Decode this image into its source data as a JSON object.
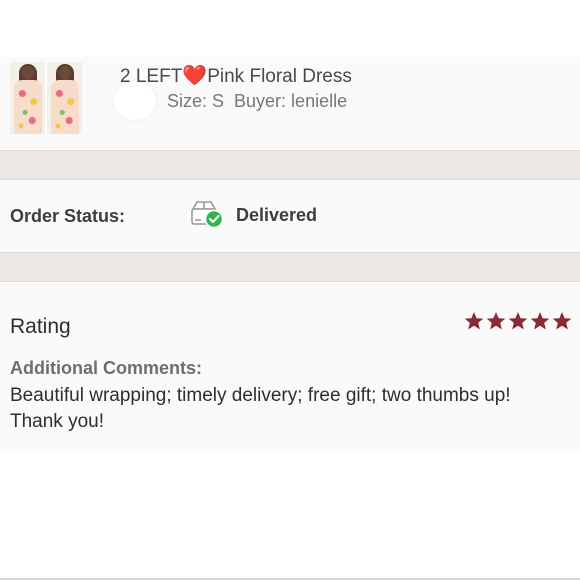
{
  "listing": {
    "title_prefix": "2 LEFT",
    "heart": "❤️",
    "title_suffix": "Pink Floral Dress",
    "size_text": "Size: S",
    "buyer_text": "Buyer: lenielle"
  },
  "order": {
    "status_label": "Order Status:",
    "status_value": "Delivered",
    "status_icon": "package-delivered-icon"
  },
  "rating": {
    "title": "Rating",
    "stars": 5,
    "star_color": "#8a2a35",
    "comments_label": "Additional Comments:",
    "comments_line1": "Beautiful wrapping; timely delivery; free gift; two thumbs up!",
    "comments_line2": "Thank you!"
  },
  "colors": {
    "band": "#ece9e4",
    "card": "#fbfafb",
    "check_green": "#2fb54a",
    "heart_red": "#e0283b"
  }
}
